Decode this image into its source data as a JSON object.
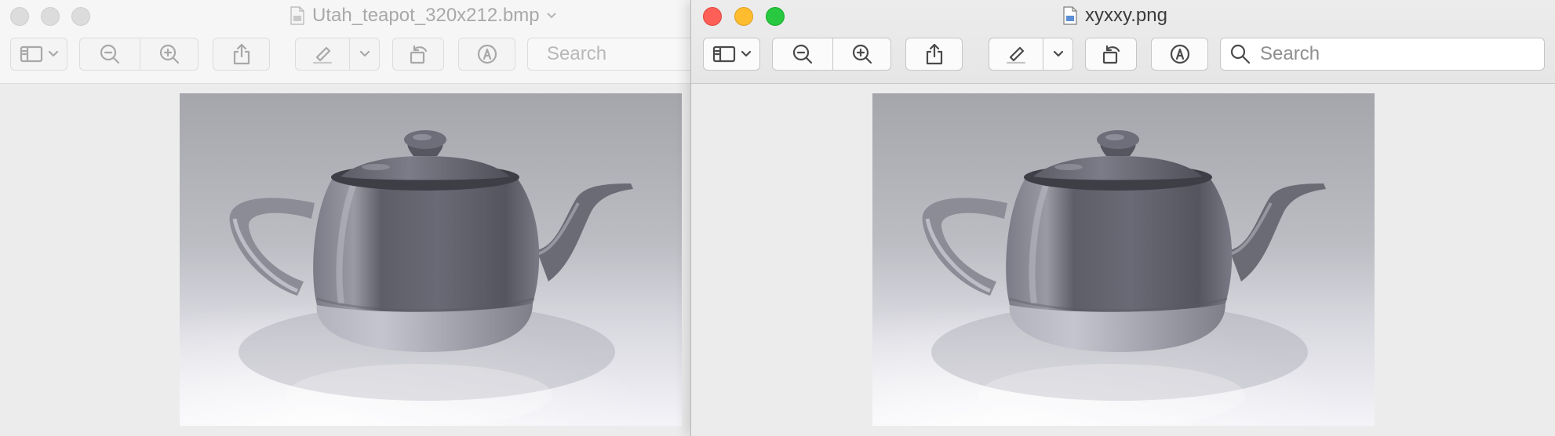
{
  "windows": [
    {
      "id": "back",
      "title": "Utah_teapot_320x212.bmp",
      "active": false,
      "search_placeholder": "Search"
    },
    {
      "id": "front",
      "title": "xyxxy.png",
      "active": true,
      "search_placeholder": "Search"
    }
  ],
  "toolbar_icons": [
    "sidebar-icon",
    "chevron-down-icon",
    "zoom-out-icon",
    "zoom-in-icon",
    "share-icon",
    "highlight-icon",
    "rotate-icon",
    "markup-icon",
    "search-icon"
  ],
  "image": {
    "subject": "teapot"
  },
  "colors": {
    "close": "#fe5f57",
    "minimize": "#febc2e",
    "maximize": "#28c840"
  }
}
